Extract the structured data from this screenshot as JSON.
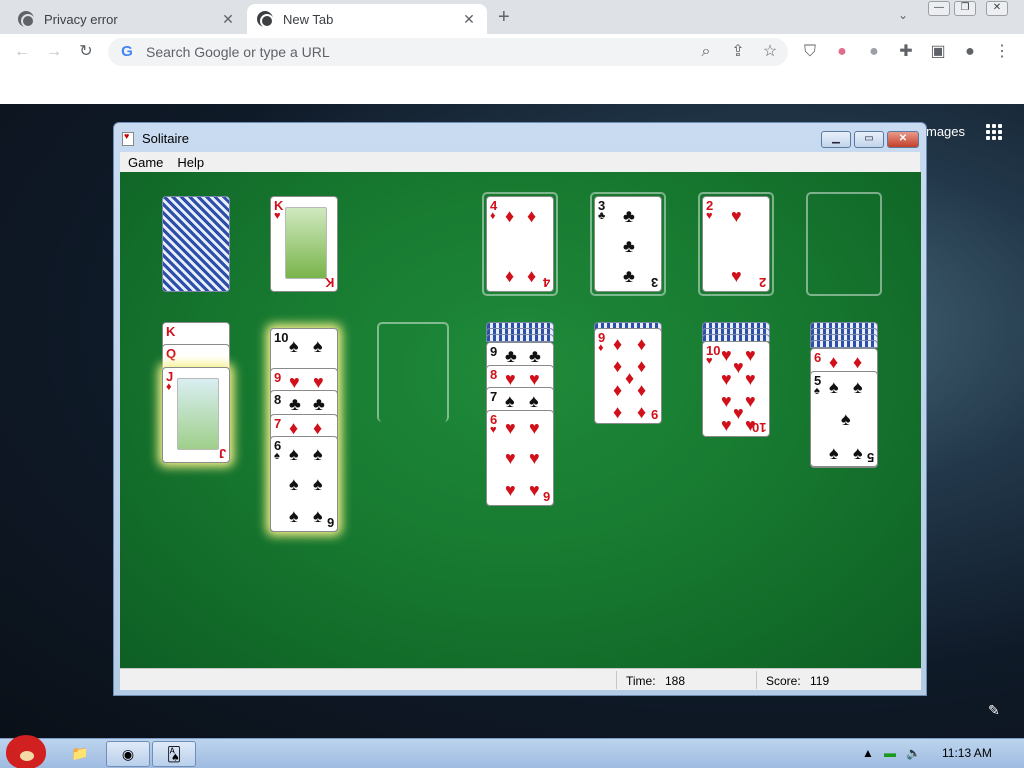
{
  "browser": {
    "tabs": [
      {
        "title": "Privacy error",
        "close": "✕"
      },
      {
        "title": "New Tab",
        "close": "✕"
      }
    ],
    "new_tab": "+",
    "tab_dropdown": "⌄",
    "omnibox_placeholder": "Search Google or type a URL",
    "google_letter": "G",
    "images_link": "mages"
  },
  "solitaire": {
    "title": "Solitaire",
    "menu": [
      "Game",
      "Help"
    ],
    "status": {
      "time_label": "Time:",
      "time_value": "188",
      "score_label": "Score:",
      "score_value": "119"
    },
    "foundations": [
      {
        "rank": "4",
        "suit": "♦",
        "color": "red"
      },
      {
        "rank": "3",
        "suit": "♣",
        "color": "blk"
      },
      {
        "rank": "2",
        "suit": "♥",
        "color": "red"
      }
    ],
    "waste_top": {
      "rank": "K",
      "suit": "♥"
    },
    "tableau": {
      "col1": [
        {
          "rank": "K",
          "suit": "♦"
        },
        {
          "rank": "Q",
          "suit": "♥"
        },
        {
          "rank": "J",
          "suit": "♦"
        }
      ],
      "col2": [
        {
          "rank": "10",
          "suit": "♠"
        },
        {
          "rank": "9",
          "suit": "♥"
        },
        {
          "rank": "8",
          "suit": "♣"
        },
        {
          "rank": "7",
          "suit": "♦"
        },
        {
          "rank": "6",
          "suit": "♠"
        }
      ],
      "col4": [
        {
          "rank": "9",
          "suit": "♣"
        },
        {
          "rank": "8",
          "suit": "♥"
        },
        {
          "rank": "7",
          "suit": "♠"
        },
        {
          "rank": "6",
          "suit": "♥"
        }
      ],
      "col5": [
        {
          "rank": "9",
          "suit": "♦"
        }
      ],
      "col6": [
        {
          "rank": "10",
          "suit": "♥"
        }
      ],
      "col7": [
        {
          "rank": "6",
          "suit": "♦"
        },
        {
          "rank": "5",
          "suit": "♠"
        }
      ]
    }
  },
  "taskbar": {
    "clock": "11:13 AM"
  }
}
